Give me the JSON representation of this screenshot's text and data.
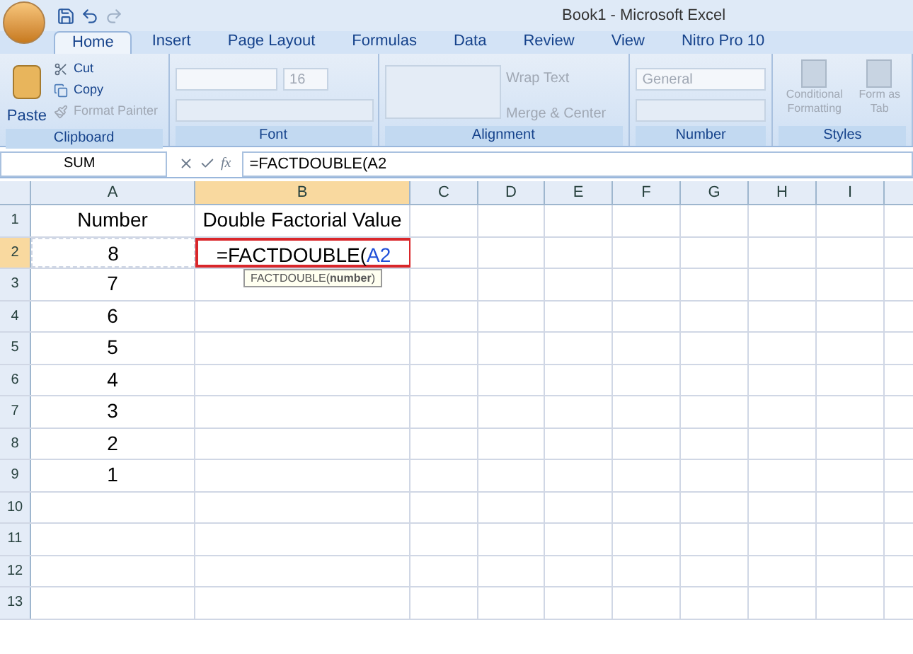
{
  "window": {
    "title": "Book1 - Microsoft Excel"
  },
  "tabs": [
    {
      "label": "Home",
      "selected": true
    },
    {
      "label": "Insert",
      "selected": false
    },
    {
      "label": "Page Layout",
      "selected": false
    },
    {
      "label": "Formulas",
      "selected": false
    },
    {
      "label": "Data",
      "selected": false
    },
    {
      "label": "Review",
      "selected": false
    },
    {
      "label": "View",
      "selected": false
    },
    {
      "label": "Nitro Pro 10",
      "selected": false
    }
  ],
  "ribbon": {
    "clipboard": {
      "label": "Clipboard",
      "paste": "Paste",
      "items": [
        {
          "label": "Cut",
          "disabled": false
        },
        {
          "label": "Copy",
          "disabled": false
        },
        {
          "label": "Format Painter",
          "disabled": true
        }
      ]
    },
    "font": {
      "label": "Font",
      "size": "16"
    },
    "alignment": {
      "label": "Alignment",
      "items": [
        {
          "label": "Wrap Text",
          "disabled": true
        },
        {
          "label": "Merge & Center",
          "disabled": true
        }
      ]
    },
    "number": {
      "label": "Number",
      "format": "General"
    },
    "styles": {
      "label": "Styles",
      "items": [
        {
          "label": "Conditional Formatting",
          "disabled": true
        },
        {
          "label": "Form as Tab",
          "disabled": true
        }
      ]
    }
  },
  "formula_bar": {
    "name_box": "SUM",
    "formula": "=FACTDOUBLE(A2",
    "function_label": "fx"
  },
  "columns": [
    {
      "label": "A",
      "selected": false
    },
    {
      "label": "B",
      "selected": true
    },
    {
      "label": "C",
      "selected": false
    },
    {
      "label": "D",
      "selected": false
    },
    {
      "label": "E",
      "selected": false
    },
    {
      "label": "F",
      "selected": false
    },
    {
      "label": "G",
      "selected": false
    },
    {
      "label": "H",
      "selected": false
    },
    {
      "label": "I",
      "selected": false
    }
  ],
  "rows": [
    {
      "label": "1",
      "selected": false,
      "a": "Number",
      "b": "Double Factorial Value"
    },
    {
      "label": "2",
      "selected": true,
      "a": "8",
      "b_formula": "=FACTDOUBLE(",
      "b_reference": "A2",
      "copy_marquee": true
    },
    {
      "label": "3",
      "selected": false,
      "a": "7"
    },
    {
      "label": "4",
      "selected": false,
      "a": "6"
    },
    {
      "label": "5",
      "selected": false,
      "a": "5"
    },
    {
      "label": "6",
      "selected": false,
      "a": "4"
    },
    {
      "label": "7",
      "selected": false,
      "a": "3"
    },
    {
      "label": "8",
      "selected": false,
      "a": "2"
    },
    {
      "label": "9",
      "selected": false,
      "a": "1"
    },
    {
      "label": "10",
      "selected": false
    },
    {
      "label": "11",
      "selected": false
    },
    {
      "label": "12",
      "selected": false
    },
    {
      "label": "13",
      "selected": false
    }
  ],
  "tooltip": "FACTDOUBLE(**number**)"
}
